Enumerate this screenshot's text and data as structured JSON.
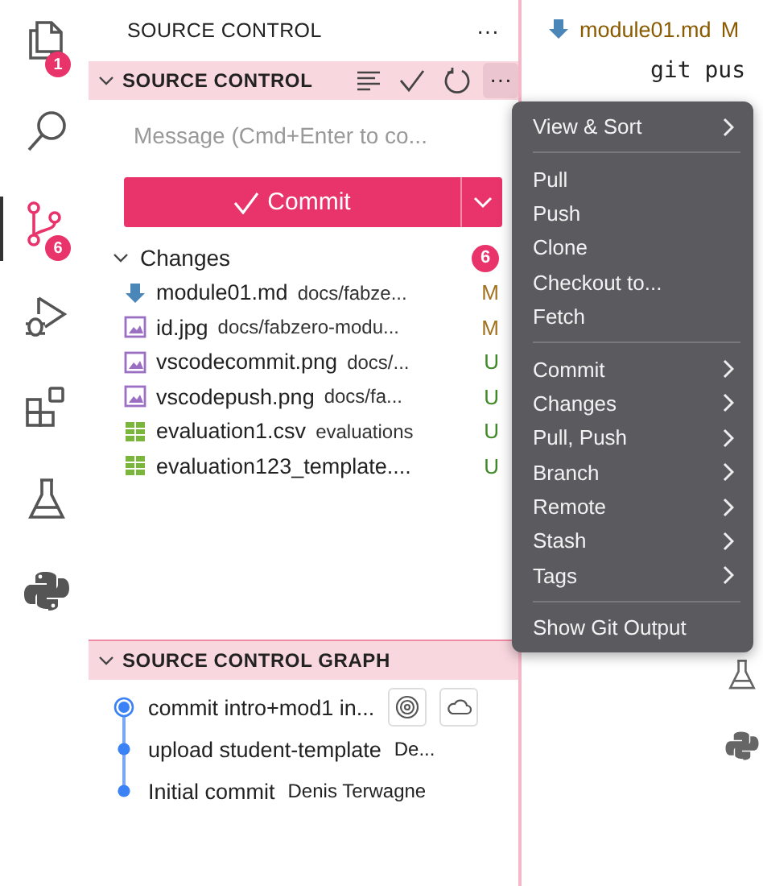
{
  "activity_bar": [
    {
      "kind": "files",
      "selected": false,
      "badge": "1"
    },
    {
      "kind": "search",
      "selected": false
    },
    {
      "kind": "scm",
      "selected": true,
      "badge": "6"
    },
    {
      "kind": "debug",
      "selected": false
    },
    {
      "kind": "extensions",
      "selected": false
    },
    {
      "kind": "flask",
      "selected": false
    },
    {
      "kind": "python",
      "selected": false
    }
  ],
  "sidebar": {
    "title": "SOURCE CONTROL",
    "more": "···",
    "section": {
      "title": "SOURCE CONTROL",
      "expanded": true
    },
    "message": {
      "placeholder": "Message (Cmd+Enter to co..."
    },
    "commit_button": "Commit",
    "changes": {
      "label": "Changes",
      "expanded": true,
      "count": "6",
      "files": [
        {
          "kind": "markdown",
          "name": "module01.md",
          "path": "docs/fabze...",
          "status": "M",
          "color": "#a0711e"
        },
        {
          "kind": "image",
          "name": "id.jpg",
          "path": "docs/fabzero-modu...",
          "status": "M",
          "color": "#a0711e"
        },
        {
          "kind": "image",
          "name": "vscodecommit.png",
          "path": "docs/...",
          "status": "U",
          "color": "#3f8a27"
        },
        {
          "kind": "image",
          "name": "vscodepush.png",
          "path": "docs/fa...",
          "status": "U",
          "color": "#3f8a27"
        },
        {
          "kind": "table",
          "name": "evaluation1.csv",
          "path": "evaluations",
          "status": "U",
          "color": "#3f8a27"
        },
        {
          "kind": "table",
          "name": "evaluation123_template....",
          "status": "U",
          "color": "#3f8a27"
        }
      ]
    },
    "graph": {
      "title": "SOURCE CONTROL GRAPH",
      "expanded": true,
      "commits": [
        {
          "message": "commit intro+mod1 in...",
          "head": true
        },
        {
          "message": "upload student-template",
          "author": "De...",
          "head": false
        },
        {
          "message": "Initial commit",
          "author": "Denis Terwagne",
          "head": false
        }
      ]
    }
  },
  "editor": {
    "tab": {
      "name": "module01.md",
      "status": "M"
    },
    "code": "git pus"
  },
  "menu": {
    "groups": [
      [
        {
          "label": "View & Sort",
          "submenu": true
        }
      ],
      [
        {
          "label": "Pull",
          "submenu": false
        },
        {
          "label": "Push",
          "submenu": false
        },
        {
          "label": "Clone",
          "submenu": false
        },
        {
          "label": "Checkout to...",
          "submenu": false
        },
        {
          "label": "Fetch",
          "submenu": false
        }
      ],
      [
        {
          "label": "Commit",
          "submenu": true
        },
        {
          "label": "Changes",
          "submenu": true
        },
        {
          "label": "Pull, Push",
          "submenu": true
        },
        {
          "label": "Branch",
          "submenu": true
        },
        {
          "label": "Remote",
          "submenu": true
        },
        {
          "label": "Stash",
          "submenu": true
        },
        {
          "label": "Tags",
          "submenu": true
        }
      ],
      [
        {
          "label": "Show Git Output",
          "submenu": false
        }
      ]
    ]
  }
}
